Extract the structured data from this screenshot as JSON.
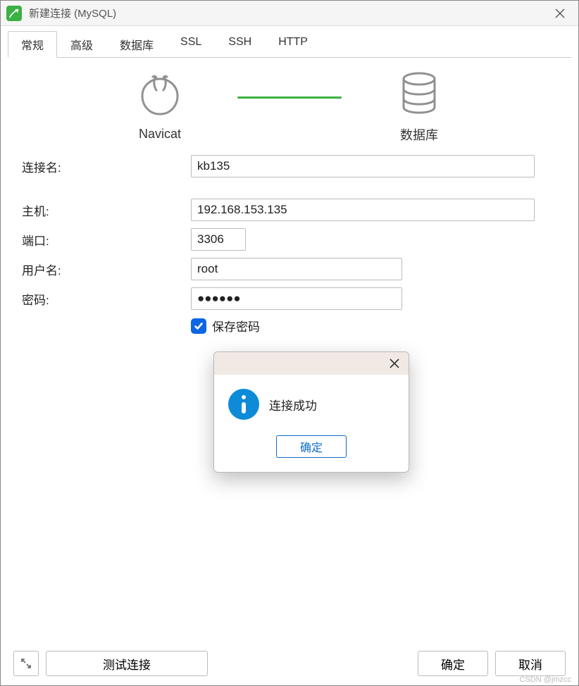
{
  "titlebar": {
    "title": "新建连接 (MySQL)"
  },
  "tabs": [
    {
      "label": "常规",
      "active": true
    },
    {
      "label": "高级",
      "active": false
    },
    {
      "label": "数据库",
      "active": false
    },
    {
      "label": "SSL",
      "active": false
    },
    {
      "label": "SSH",
      "active": false
    },
    {
      "label": "HTTP",
      "active": false
    }
  ],
  "diagram": {
    "left_label": "Navicat",
    "right_label": "数据库"
  },
  "form": {
    "connection_name": {
      "label": "连接名:",
      "value": "kb135"
    },
    "host": {
      "label": "主机:",
      "value": "192.168.153.135"
    },
    "port": {
      "label": "端口:",
      "value": "3306"
    },
    "username": {
      "label": "用户名:",
      "value": "root"
    },
    "password": {
      "label": "密码:",
      "value": "●●●●●●"
    },
    "save_password": {
      "label": "保存密码",
      "checked": true
    }
  },
  "popup": {
    "message": "连接成功",
    "ok_label": "确定"
  },
  "footer": {
    "test_label": "测试连接",
    "ok_label": "确定",
    "cancel_label": "取消"
  },
  "watermark": "CSDN @jmzcc"
}
